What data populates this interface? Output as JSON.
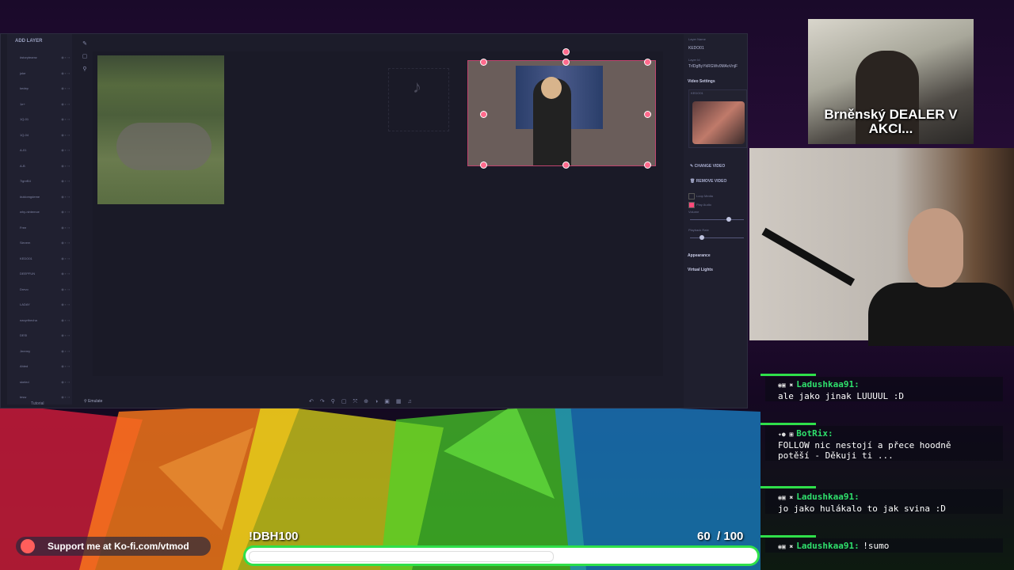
{
  "app": {
    "add_layer": "ADD LAYER",
    "tutorial": "Tutorial",
    "emulate": "Emulate",
    "layers": [
      {
        "name": "#storyteamz"
      },
      {
        "name": "joke"
      },
      {
        "name": "kedep"
      },
      {
        "name": "1e+"
      },
      {
        "name": "1Q-01"
      },
      {
        "name": "1Q-04"
      },
      {
        "name": "A-01"
      },
      {
        "name": "A-B"
      },
      {
        "name": "7ignrB4"
      },
      {
        "name": "#uklomgdeme"
      },
      {
        "name": "why-nintemoe"
      },
      {
        "name": "Free"
      },
      {
        "name": "Sievem"
      },
      {
        "name": "KEDO01"
      },
      {
        "name": "DEEPFUN"
      },
      {
        "name": "Drevo"
      },
      {
        "name": "LADAY"
      },
      {
        "name": "navyrthecha"
      },
      {
        "name": "DESI"
      },
      {
        "name": "Jeremy"
      },
      {
        "name": "Ahled"
      },
      {
        "name": "skeled"
      },
      {
        "name": "tesw"
      }
    ],
    "right_panel": {
      "layer_name_label": "Layer Name",
      "layer_name_value": "KEDO01",
      "layer_id_label": "Layer Id",
      "layer_id_value": "TrIDgByYkRGWv0MAoVnjF",
      "video_settings": "Video Settings",
      "video_file": "KEDO01",
      "change_video": "CHANGE VIDEO",
      "remove_video": "REMOVE VIDEO",
      "loop_media": "Loop Media",
      "play_audio": "Play Audio",
      "volume_label": "Volume",
      "playback_rate_label": "Playback Rate",
      "appearance": "Appearance",
      "virtual_lights": "Virtual Lights"
    }
  },
  "webcam_caption": "Brněnský DEALER V AKCI...",
  "chat": [
    {
      "name": "Ladushkaa91:",
      "text": "ale jako jinak LUUUUL :D"
    },
    {
      "name": "BotRix:",
      "text": "FOLLOW nic nestojí a přece hoodně potěší - Děkuji ti ..."
    },
    {
      "name": "Ladushkaa91:",
      "text": "jo jako hulákalo to jak svina :D"
    },
    {
      "name": "Ladushkaa91:",
      "text": "!sumo"
    }
  ],
  "kofi": "Support me at Ko-fi.com/vtmod",
  "goal": {
    "title": "!DBH100",
    "current": "60",
    "total": "/ 100",
    "progress": 0.6
  },
  "colors": {
    "accent_green": "#2fe04a",
    "selection_pink": "#ff6a8c",
    "app_bg": "#1c1c2a"
  }
}
